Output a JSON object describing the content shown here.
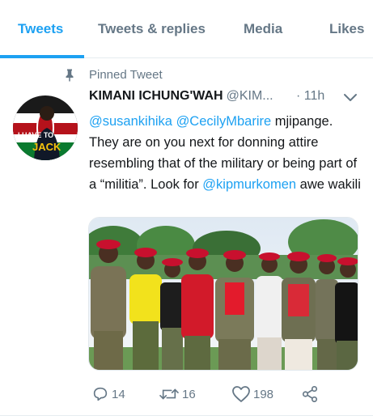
{
  "tabs": [
    {
      "label": "Tweets",
      "active": true
    },
    {
      "label": "Tweets & replies",
      "active": false
    },
    {
      "label": "Media",
      "active": false
    },
    {
      "label": "Likes",
      "active": false
    }
  ],
  "pinned": {
    "label": "Pinned Tweet",
    "icon": "pin-icon"
  },
  "tweet": {
    "author": "KIMANI ICHUNG'WAH",
    "handle": "@KIM...",
    "time": "· 11h",
    "avatar_text": "I HAVE TO... JACK",
    "text": {
      "mention1": "@susankihika",
      "mention2": "@CecilyMbarire",
      "part1": " mjipange. They are on you next for donning attire resembling that of the military or being part of a “militia”. Look for ",
      "mention3": "@kipmurkomen",
      "part2": " awe wakili"
    },
    "actions": {
      "reply": {
        "count": "14",
        "icon": "reply-icon"
      },
      "retweet": {
        "count": "16",
        "icon": "retweet-icon"
      },
      "like": {
        "count": "198",
        "icon": "heart-icon"
      },
      "share": {
        "icon": "share-icon"
      }
    }
  },
  "colors": {
    "accent": "#1da1f2",
    "muted": "#657786",
    "text": "#14171a",
    "beret": "#c8102e"
  }
}
